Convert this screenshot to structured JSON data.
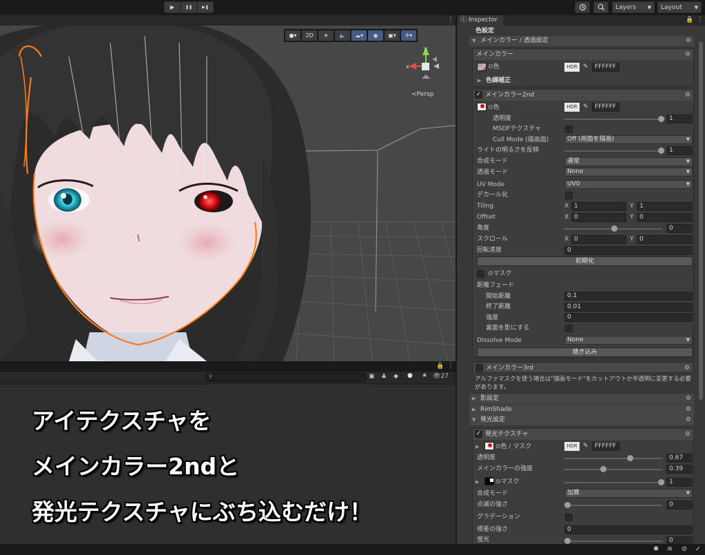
{
  "toolbar": {
    "play_icon": "▶",
    "pause_icon": "❚❚",
    "step_icon": "▶❚",
    "history_icon": "history-icon",
    "search_icon": "search-icon",
    "layers_label": "Layers",
    "layout_label": "Layout"
  },
  "scene": {
    "tools": [
      "●▾",
      "2D",
      "☀",
      "🔈",
      "☁▾",
      "◉",
      "▣▾",
      "✛▾"
    ],
    "gizmo_x": "x",
    "gizmo_y": "y",
    "persp_label": "<Persp"
  },
  "project": {
    "item_count": "27"
  },
  "caption": {
    "line1": "アイテクスチャを",
    "line2": "メインカラー2ndと",
    "line3": "発光テクスチャにぶち込むだけ！"
  },
  "inspector": {
    "tab_label": "Inspector",
    "color_settings_label": "色設定",
    "main_transparency_section": "メインカラー / 透過設定",
    "main_color": {
      "title": "メインカラー",
      "color_label": "⊙色",
      "hdr": "HDR",
      "hex": "FFFFFF",
      "color_adjust": "色調補正"
    },
    "main_color_2nd": {
      "title": "メインカラー2nd",
      "color_label": "⊙色",
      "hdr": "HDR",
      "hex": "FFFFFF",
      "opacity_label": "透明度",
      "opacity_value": "1",
      "msdf_label": "MSDFテクスチャ",
      "cull_label": "Cull Mode (描画面)",
      "cull_value": "Off (両面を描画)",
      "light_label": "ライトの明るさを反映",
      "light_value": "1",
      "blend_label": "合成モード",
      "blend_value": "通常",
      "transp_label": "透過モード",
      "transp_value": "None",
      "uv_label": "UV Mode",
      "uv_value": "UV0",
      "decal_label": "デカール化",
      "tiling_label": "Tiling",
      "tiling_x": "1",
      "tiling_y": "1",
      "offset_label": "Offset",
      "offset_x": "0",
      "offset_y": "0",
      "angle_label": "角度",
      "angle_value": "0",
      "scroll_label": "スクロール",
      "scroll_x": "0",
      "scroll_y": "0",
      "rot_label": "回転速度",
      "rot_value": "0",
      "reset_button": "初期化",
      "mask_label": "⊙マスク",
      "dist_fade_label": "距離フェード",
      "start_dist_label": "開始距離",
      "start_dist_value": "0.1",
      "end_dist_label": "終了距離",
      "end_dist_value": "0.01",
      "strength_label": "強度",
      "strength_value": "0",
      "backface_label": "裏面を影にする",
      "dissolve_label": "Dissolve Mode",
      "dissolve_value": "None",
      "bake_button": "焼き込み"
    },
    "main_color_3rd_title": "メインカラー3rd",
    "alpha_mask_note": "アルファマスクを使う場合は\"描画モード\"をカットアウトか半透明に変更する必要があります。",
    "shadow_section": "影設定",
    "rimshade_section": "RimShade",
    "emission_section": "発光設定",
    "emission": {
      "title": "発光テクスチャ",
      "color_mask_label": "⊙色 / マスク",
      "hdr": "HDR",
      "hex": "FFFFFF",
      "opacity_label": "透明度",
      "opacity_value": "0.67",
      "main_strength_label": "メインカラーの強度",
      "main_strength_value": "0.39",
      "mask_label": "⊙マスク",
      "mask_value": "1",
      "blend_label": "合成モード",
      "blend_value": "加算",
      "blink_label": "点滅の強さ",
      "blink_value": "0",
      "gradation_label": "グラデーション",
      "parallax_label": "視差の強さ",
      "parallax_value": "0",
      "glow_label": "蛍光",
      "glow_value": "0"
    }
  },
  "colors": {
    "selection_outline": "#ff7a1a",
    "grid": "#5a5a5a",
    "accent_blue": "#465b83"
  }
}
